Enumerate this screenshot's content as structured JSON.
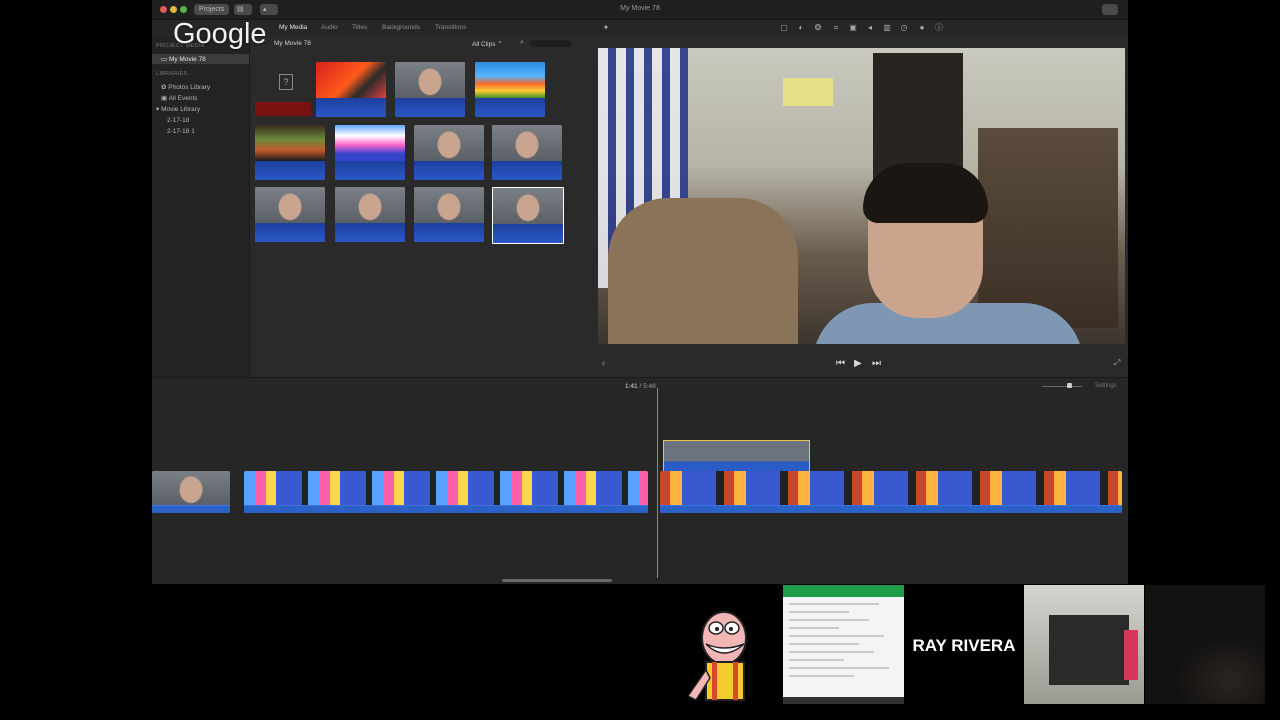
{
  "app": {
    "window_title": "My Movie 78",
    "back_button": "Projects",
    "toolbar_tabs": [
      "My Media",
      "Audio",
      "Titles",
      "Backgrounds",
      "Transitions"
    ],
    "active_tab": "My Media",
    "clip_filter": "All Clips",
    "browser_title": "My Movie 78"
  },
  "sidebar": {
    "project_media_heading": "PROJECT MEDIA",
    "project_item": "My Movie 78",
    "libraries_heading": "LIBRARIES",
    "items": [
      "Photos Library",
      "All Events",
      "Movie Library",
      "2-17-18",
      "2-17-18 1"
    ]
  },
  "timeline": {
    "current_time": "1:41",
    "total_time": "5:48",
    "settings_label": "Settings"
  },
  "overlay": {
    "watermark": "Google",
    "participant_name": "RAY RIVERA"
  },
  "colors": {
    "app_bg": "#2a2a2a",
    "timeline_clip": "#1f5fd6",
    "selected_border": "#e5c547"
  }
}
